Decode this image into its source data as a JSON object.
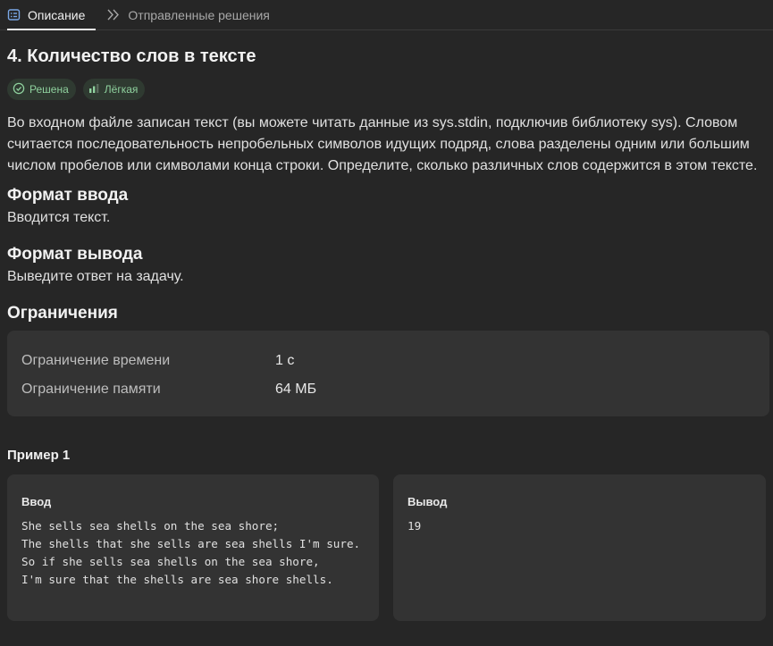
{
  "tabs": [
    {
      "label": "Описание",
      "icon": "description-icon",
      "active": true
    },
    {
      "label": "Отправленные решения",
      "icon": "double-chevron-icon",
      "active": false
    }
  ],
  "problem": {
    "title": "4. Количество слов в тексте",
    "badges": [
      {
        "label": "Решена",
        "icon": "check-circle-icon"
      },
      {
        "label": "Лёгкая",
        "icon": "difficulty-bars-icon"
      }
    ],
    "description": "Во входном файле записан текст (вы можете читать данные из sys.stdin, подключив библиотеку sys). Словом считается последовательность непробельных символов идущих подряд, слова разделены одним или большим числом пробелов или символами конца строки. Определите, сколько различных слов содержится в этом тексте."
  },
  "input_format": {
    "heading": "Формат ввода",
    "text": "Вводится текст."
  },
  "output_format": {
    "heading": "Формат вывода",
    "text": "Выведите ответ на задачу."
  },
  "limits": {
    "heading": "Ограничения",
    "rows": [
      {
        "label": "Ограничение времени",
        "value": "1 с"
      },
      {
        "label": "Ограничение памяти",
        "value": "64 МБ"
      }
    ]
  },
  "example": {
    "title": "Пример 1",
    "input_label": "Ввод",
    "input_text": "She sells sea shells on the sea shore;\nThe shells that she sells are sea shells I'm sure.\nSo if she sells sea shells on the sea shore,\nI'm sure that the shells are sea shore shells.",
    "output_label": "Вывод",
    "output_text": "19"
  },
  "colors": {
    "background": "#262626",
    "panel": "#333333",
    "badge_bg": "#2f3a31",
    "badge_text": "#8fd19e"
  }
}
